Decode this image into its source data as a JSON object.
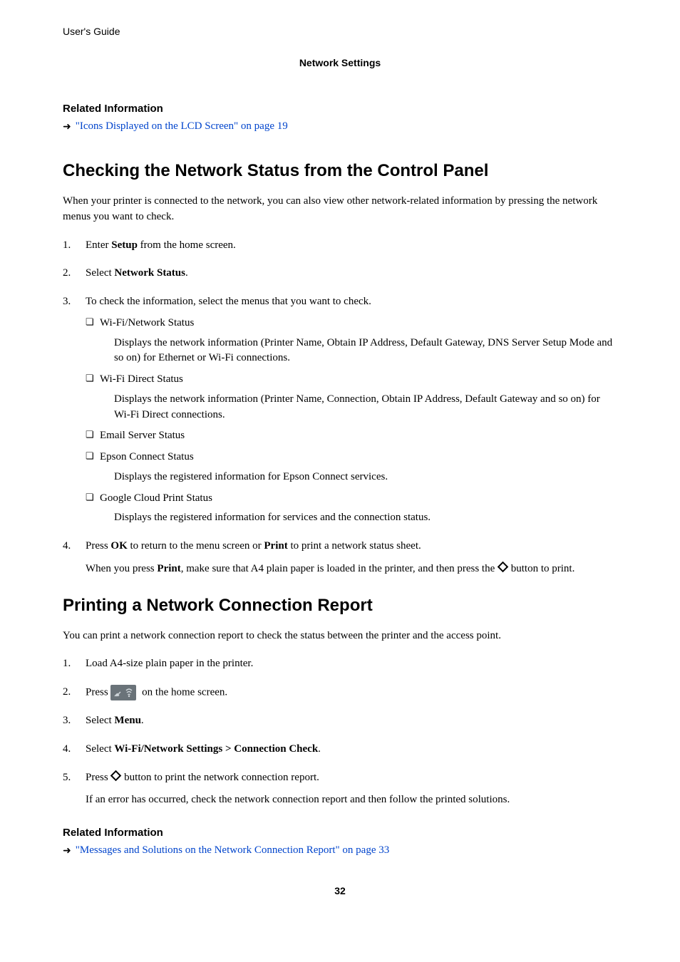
{
  "header": {
    "guide": "User's Guide",
    "breadcrumb": "Network Settings"
  },
  "relatedTop": {
    "heading": "Related Information",
    "link": "\"Icons Displayed on the LCD Screen\" on page 19"
  },
  "section1": {
    "title": "Checking the Network Status from the Control Panel",
    "intro": "When your printer is connected to the network, you can also view other network-related information by pressing the network menus you want to check.",
    "step1_pre": "Enter ",
    "step1_bold": "Setup",
    "step1_post": " from the home screen.",
    "step2_pre": "Select ",
    "step2_bold": "Network Status",
    "step2_post": ".",
    "step3": "To check the information, select the menus that you want to check.",
    "s3a_label": "Wi-Fi/Network Status",
    "s3a_desc": "Displays the network information (Printer Name, Obtain IP Address, Default Gateway, DNS Server Setup Mode and so on) for Ethernet or Wi-Fi connections.",
    "s3b_label": "Wi-Fi Direct Status",
    "s3b_desc": "Displays the network information (Printer Name, Connection, Obtain IP Address, Default Gateway and so on) for Wi-Fi Direct connections.",
    "s3c_label": "Email Server Status",
    "s3d_label": "Epson Connect Status",
    "s3d_desc": "Displays the registered information for Epson Connect services.",
    "s3e_label": "Google Cloud Print Status",
    "s3e_desc": "Displays the registered information for services and the connection status.",
    "step4_pre": "Press ",
    "step4_b1": "OK",
    "step4_mid": " to return to the menu screen or ",
    "step4_b2": "Print",
    "step4_post": " to print a network status sheet.",
    "step4_sub_pre": "When you press ",
    "step4_sub_b": "Print",
    "step4_sub_mid": ", make sure that A4 plain paper is loaded in the printer, and then press the ",
    "step4_sub_post": " button to print."
  },
  "section2": {
    "title": "Printing a Network Connection Report",
    "intro": "You can print a network connection report to check the status between the printer and the access point.",
    "step1": "Load A4-size plain paper in the printer.",
    "step2_pre": "Press ",
    "step2_post": " on the home screen.",
    "step3_pre": "Select ",
    "step3_bold": "Menu",
    "step3_post": ".",
    "step4_pre": "Select ",
    "step4_bold": "Wi-Fi/Network Settings > Connection Check",
    "step4_post": ".",
    "step5_pre": "Press ",
    "step5_post": " button to print the network connection report.",
    "step5_sub": "If an error has occurred, check the network connection report and then follow the printed solutions."
  },
  "relatedBottom": {
    "heading": "Related Information",
    "link": "\"Messages and Solutions on the Network Connection Report\" on page 33"
  },
  "pageNumber": "32"
}
